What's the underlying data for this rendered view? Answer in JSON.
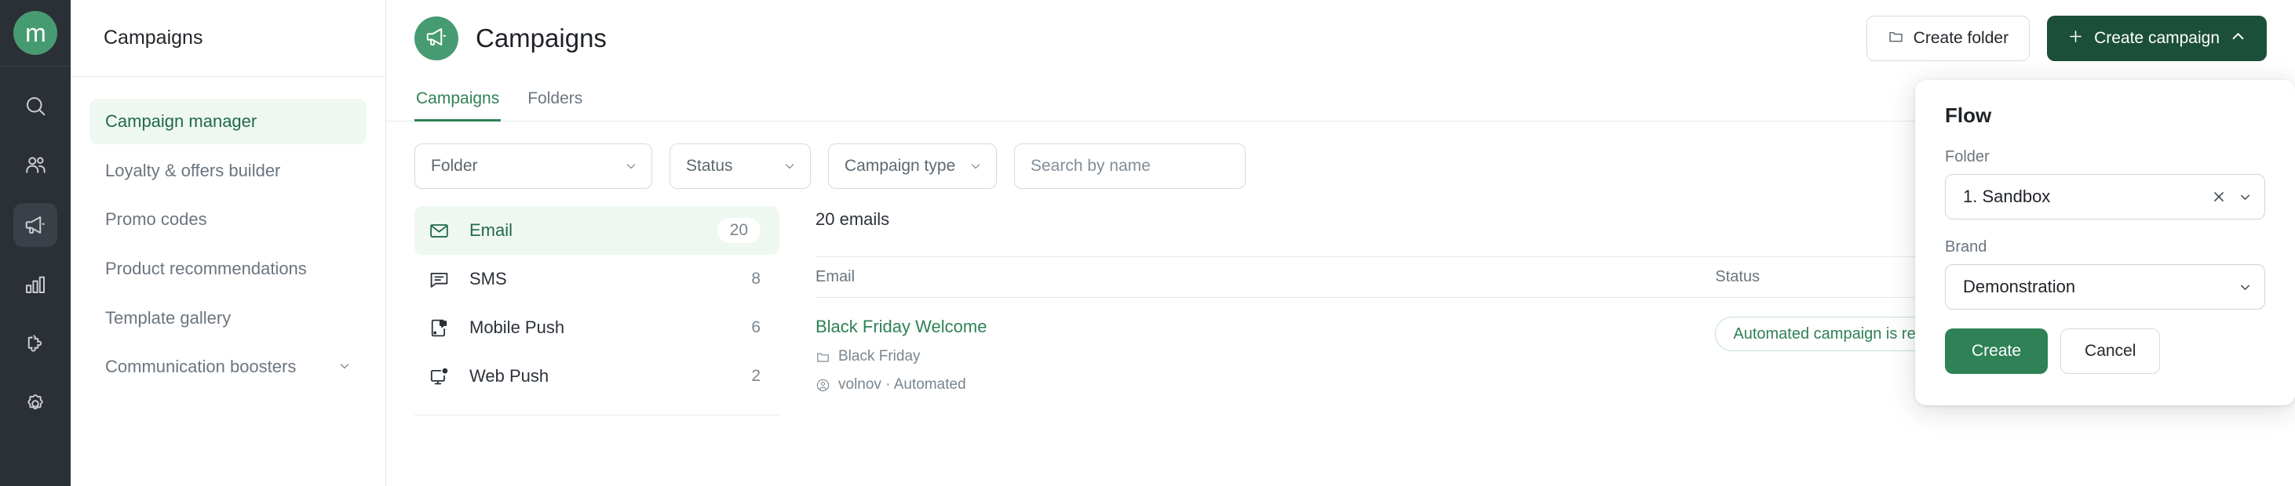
{
  "rail": {
    "logo_letter": "m",
    "items": [
      {
        "name": "search-icon",
        "active": false
      },
      {
        "name": "contacts-icon",
        "active": false
      },
      {
        "name": "megaphone-icon",
        "active": true
      },
      {
        "name": "analytics-icon",
        "active": false
      },
      {
        "name": "integrations-icon",
        "active": false
      },
      {
        "name": "settings-icon",
        "active": false
      }
    ]
  },
  "subnav": {
    "title": "Campaigns",
    "items": [
      {
        "label": "Campaign manager",
        "active": true,
        "chevron": false
      },
      {
        "label": "Loyalty & offers builder",
        "active": false,
        "chevron": false
      },
      {
        "label": "Promo codes",
        "active": false,
        "chevron": false
      },
      {
        "label": "Product recommendations",
        "active": false,
        "chevron": false
      },
      {
        "label": "Template gallery",
        "active": false,
        "chevron": false
      },
      {
        "label": "Communication boosters",
        "active": false,
        "chevron": true
      }
    ]
  },
  "header": {
    "title": "Campaigns",
    "avatar_icon": "megaphone-icon",
    "create_folder_label": "Create folder",
    "create_campaign_label": "Create campaign"
  },
  "tabs": [
    {
      "label": "Campaigns",
      "active": true
    },
    {
      "label": "Folders",
      "active": false
    }
  ],
  "filters": {
    "folder_label": "Folder",
    "status_label": "Status",
    "campaign_type_label": "Campaign type",
    "search_placeholder": "Search by name",
    "search_value": "",
    "view_toggle_icon": "list-view-icon"
  },
  "channels": [
    {
      "label": "Email",
      "count": "20",
      "icon": "envelope-icon",
      "active": true
    },
    {
      "label": "SMS",
      "count": "8",
      "icon": "chat-bubble-icon",
      "active": false
    },
    {
      "label": "Mobile Push",
      "count": "6",
      "icon": "mobile-push-icon",
      "active": false
    },
    {
      "label": "Web Push",
      "count": "2",
      "icon": "web-push-icon",
      "active": false
    }
  ],
  "table": {
    "count_text": "20 emails",
    "columns": {
      "email": "Email",
      "status": "Status"
    },
    "rows": [
      {
        "name": "Black Friday Welcome",
        "folder": "Black Friday",
        "author": "volnov · Automated",
        "status": "Automated campaign is ready"
      }
    ]
  },
  "popover": {
    "title": "Flow",
    "folder_label": "Folder",
    "folder_value": "1. Sandbox",
    "brand_label": "Brand",
    "brand_value": "Demonstration",
    "create_label": "Create",
    "cancel_label": "Cancel"
  },
  "colors": {
    "brand_green": "#2f8156",
    "dark_green": "#1c4f39",
    "avatar_green": "#479b72",
    "rail_bg": "#2b2f36",
    "active_tint": "#eef8f1"
  }
}
